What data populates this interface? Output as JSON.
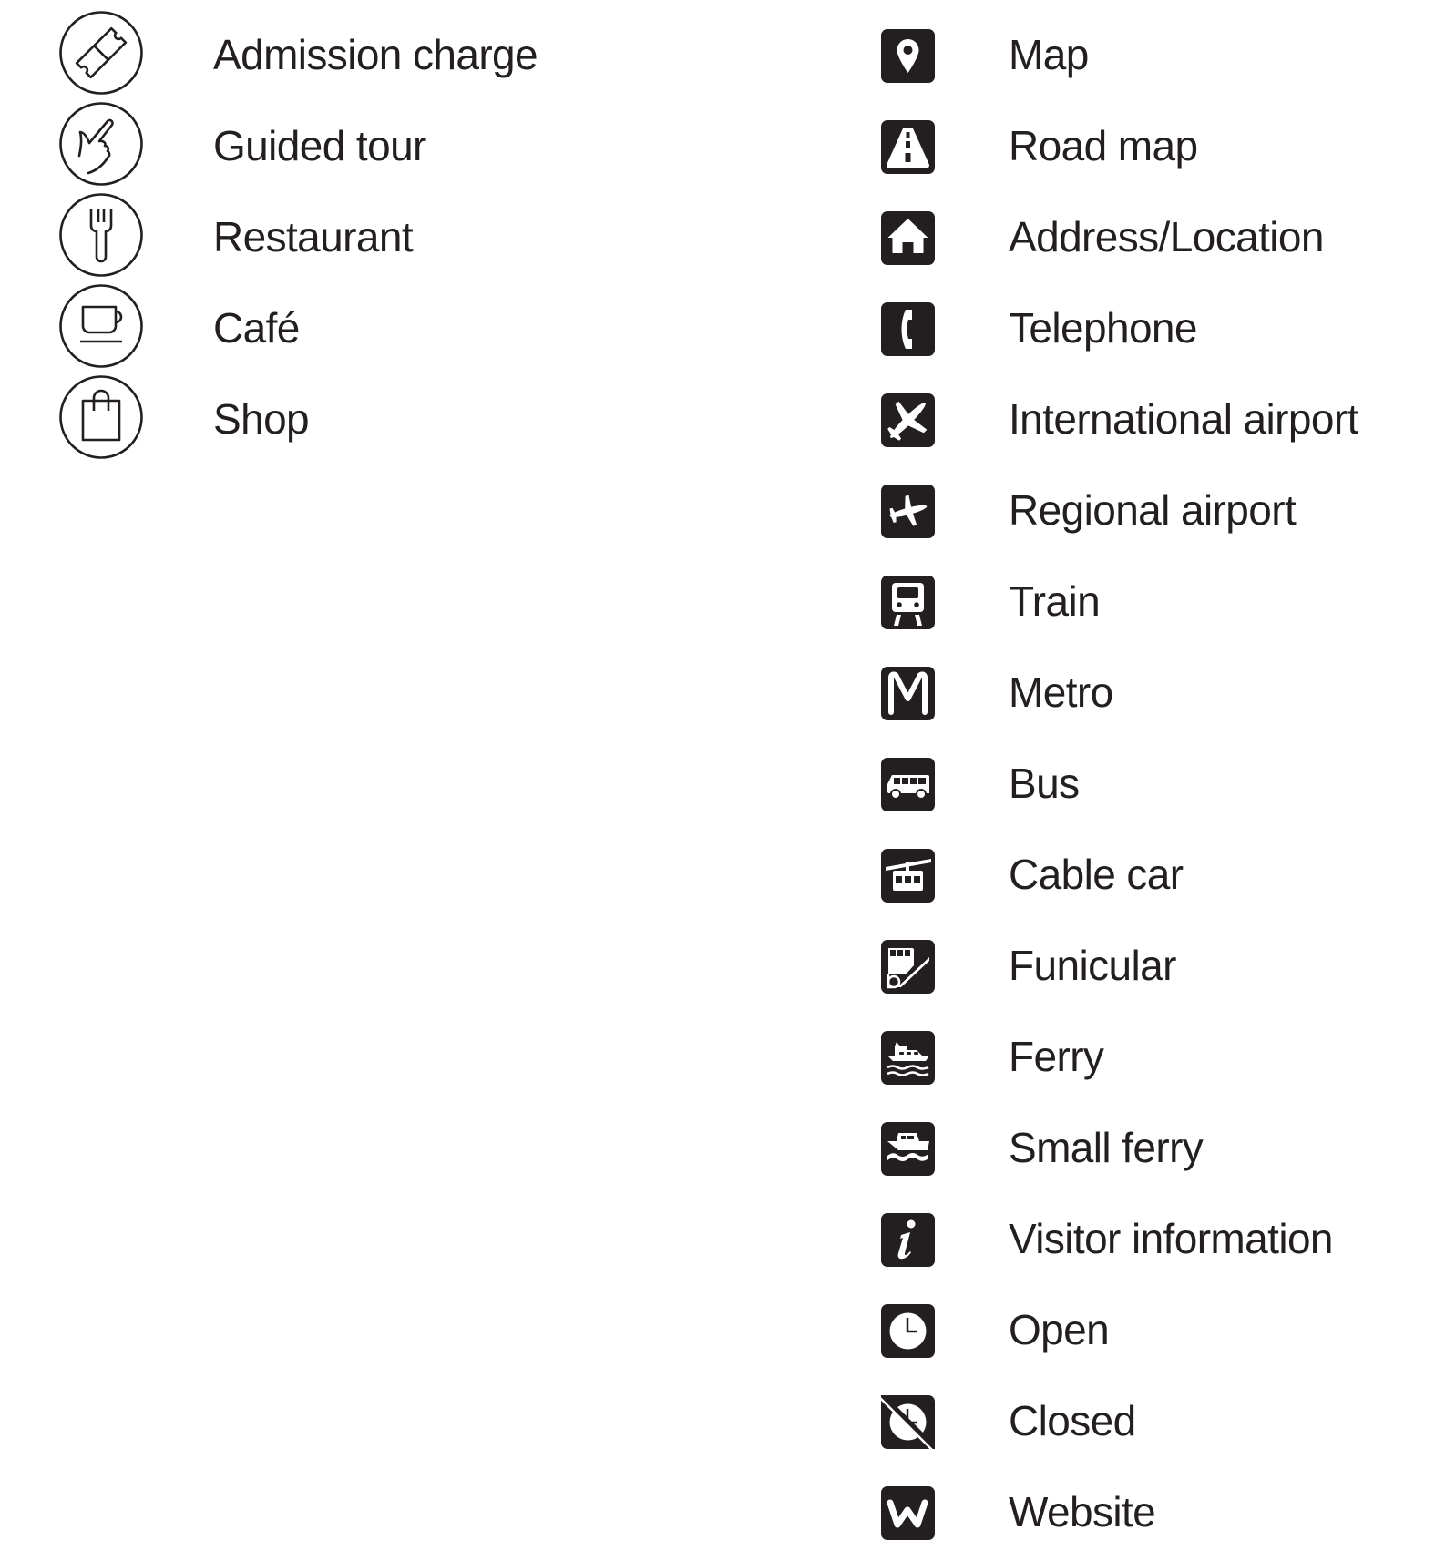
{
  "legend": {
    "amenities": [
      {
        "icon": "ticket-icon",
        "label": "Admission charge"
      },
      {
        "icon": "pointing-hand-icon",
        "label": "Guided tour"
      },
      {
        "icon": "fork-icon",
        "label": "Restaurant"
      },
      {
        "icon": "coffee-cup-icon",
        "label": "Café"
      },
      {
        "icon": "shopping-bag-icon",
        "label": "Shop"
      }
    ],
    "information": [
      {
        "icon": "map-pin-icon",
        "label": "Map"
      },
      {
        "icon": "road-icon",
        "label": "Road map"
      },
      {
        "icon": "house-icon",
        "label": "Address/Location"
      },
      {
        "icon": "telephone-icon",
        "label": "Telephone"
      },
      {
        "icon": "large-plane-icon",
        "label": "International airport"
      },
      {
        "icon": "small-plane-icon",
        "label": "Regional airport"
      },
      {
        "icon": "train-icon",
        "label": "Train"
      },
      {
        "icon": "metro-icon",
        "label": "Metro"
      },
      {
        "icon": "bus-icon",
        "label": "Bus"
      },
      {
        "icon": "cable-car-icon",
        "label": "Cable car"
      },
      {
        "icon": "funicular-icon",
        "label": "Funicular"
      },
      {
        "icon": "ferry-icon",
        "label": "Ferry"
      },
      {
        "icon": "small-ferry-icon",
        "label": "Small ferry"
      },
      {
        "icon": "info-icon",
        "label": "Visitor information"
      },
      {
        "icon": "clock-icon",
        "label": "Open"
      },
      {
        "icon": "clock-crossed-icon",
        "label": "Closed"
      },
      {
        "icon": "website-w-icon",
        "label": "Website"
      }
    ]
  },
  "colors": {
    "ink": "#231f20",
    "background": "#ffffff"
  }
}
